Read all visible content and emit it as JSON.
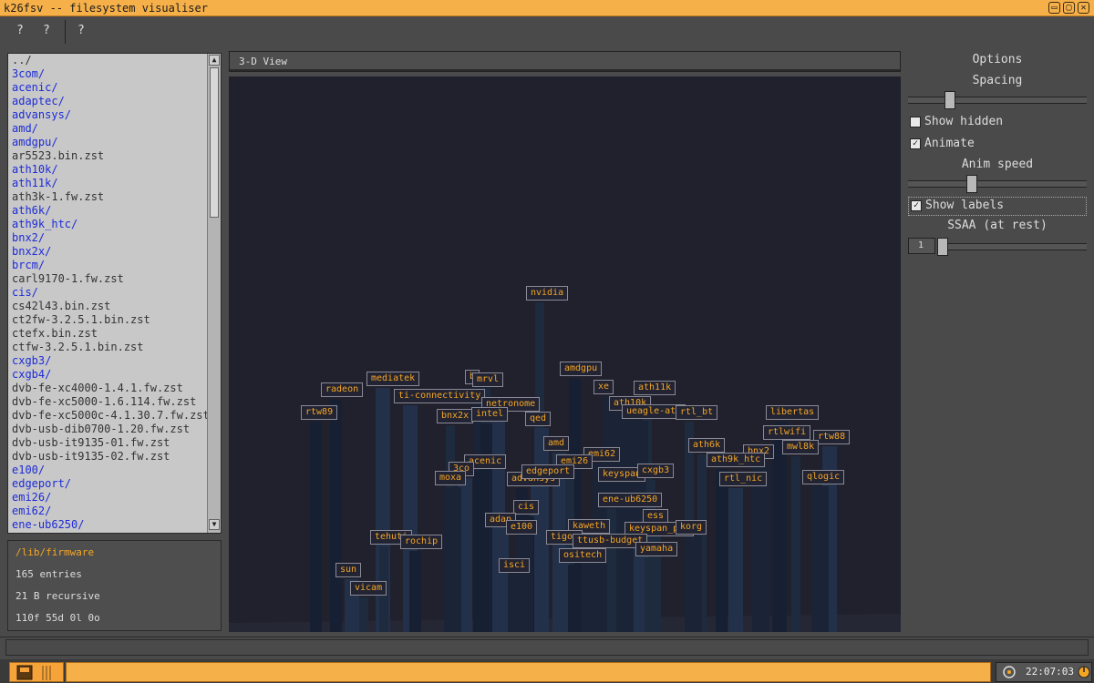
{
  "window": {
    "title": "k26fsv -- filesystem visualiser",
    "min_glyph": "▭",
    "max_glyph": "▢",
    "close_glyph": "✕",
    "icons": [
      "minimize-icon",
      "maximize-icon",
      "close-icon"
    ]
  },
  "menu": {
    "items": [
      "?",
      "?",
      "?"
    ]
  },
  "file_list": {
    "entries": [
      {
        "name": "../",
        "dir": false
      },
      {
        "name": "3com/",
        "dir": true
      },
      {
        "name": "acenic/",
        "dir": true
      },
      {
        "name": "adaptec/",
        "dir": true
      },
      {
        "name": "advansys/",
        "dir": true
      },
      {
        "name": "amd/",
        "dir": true
      },
      {
        "name": "amdgpu/",
        "dir": true
      },
      {
        "name": "ar5523.bin.zst",
        "dir": false
      },
      {
        "name": "ath10k/",
        "dir": true
      },
      {
        "name": "ath11k/",
        "dir": true
      },
      {
        "name": "ath3k-1.fw.zst",
        "dir": false
      },
      {
        "name": "ath6k/",
        "dir": true
      },
      {
        "name": "ath9k_htc/",
        "dir": true
      },
      {
        "name": "bnx2/",
        "dir": true
      },
      {
        "name": "bnx2x/",
        "dir": true
      },
      {
        "name": "brcm/",
        "dir": true
      },
      {
        "name": "carl9170-1.fw.zst",
        "dir": false
      },
      {
        "name": "cis/",
        "dir": true
      },
      {
        "name": "cs42l43.bin.zst",
        "dir": false
      },
      {
        "name": "ct2fw-3.2.5.1.bin.zst",
        "dir": false
      },
      {
        "name": "ctefx.bin.zst",
        "dir": false
      },
      {
        "name": "ctfw-3.2.5.1.bin.zst",
        "dir": false
      },
      {
        "name": "cxgb3/",
        "dir": true
      },
      {
        "name": "cxgb4/",
        "dir": true
      },
      {
        "name": "dvb-fe-xc4000-1.4.1.fw.zst",
        "dir": false
      },
      {
        "name": "dvb-fe-xc5000-1.6.114.fw.zst",
        "dir": false
      },
      {
        "name": "dvb-fe-xc5000c-4.1.30.7.fw.zst",
        "dir": false
      },
      {
        "name": "dvb-usb-dib0700-1.20.fw.zst",
        "dir": false
      },
      {
        "name": "dvb-usb-it9135-01.fw.zst",
        "dir": false
      },
      {
        "name": "dvb-usb-it9135-02.fw.zst",
        "dir": false
      },
      {
        "name": "e100/",
        "dir": true
      },
      {
        "name": "edgeport/",
        "dir": true
      },
      {
        "name": "emi26/",
        "dir": true
      },
      {
        "name": "emi62/",
        "dir": true
      },
      {
        "name": "ene-ub6250/",
        "dir": true
      }
    ],
    "scroll_up_glyph": "▲",
    "scroll_down_glyph": "▼"
  },
  "info": {
    "path": "/lib/firmware",
    "entries": "165 entries",
    "size": "21 B recursive",
    "counts": "110f  55d  0l  0o"
  },
  "view": {
    "title": "3-D View"
  },
  "labels": [
    "nvidia",
    "radeon",
    "mediatek",
    "b",
    "mrvl",
    "amdgpu",
    "ti-connectivity",
    "xe",
    "ath11k",
    "rtw89",
    "netronome",
    "ath10k",
    "bnx2x",
    "intel",
    "qed",
    "ueagle-atm",
    "rtl_bt",
    "libertas",
    "amd",
    "emi62",
    "ath6k",
    "rtlwifi",
    "rtw88",
    "bnx2",
    "mwl8k",
    "acenic",
    "3co",
    "moxa",
    "emi26",
    "advansys",
    "edgeport",
    "keyspan",
    "cxgb3",
    "ath9k_htc",
    "rtl_nic",
    "qlogic",
    "ene-ub6250",
    "cis",
    "adap",
    "e100",
    "ess",
    "kaweth",
    "keyspan_pda",
    "korg",
    "tehuti",
    "rochip",
    "tigon",
    "ttusb-budget",
    "yamaha",
    "ositech",
    "sun",
    "isci",
    "vicam"
  ],
  "options": {
    "title": "Options",
    "spacing_label": "Spacing",
    "spacing_value": 0.22,
    "show_hidden": {
      "label": "Show hidden",
      "checked": false
    },
    "animate": {
      "label": "Animate",
      "checked": true
    },
    "anim_speed_label": "Anim speed",
    "anim_speed_value": 0.35,
    "show_labels": {
      "label": "Show labels",
      "checked": true
    },
    "ssaa_label": "SSAA (at rest)",
    "ssaa_value": "1",
    "check_glyph": "✓"
  },
  "taskbar": {
    "clock": "22:07:03",
    "icons": [
      "app-menu-icon",
      "network-icon",
      "power-icon"
    ]
  },
  "colors": {
    "accent": "#f5a623",
    "titlebar": "#f6b04a",
    "canvas_bg": "#20212d",
    "dir_text": "#1c2bd9",
    "file_text": "#333333"
  }
}
